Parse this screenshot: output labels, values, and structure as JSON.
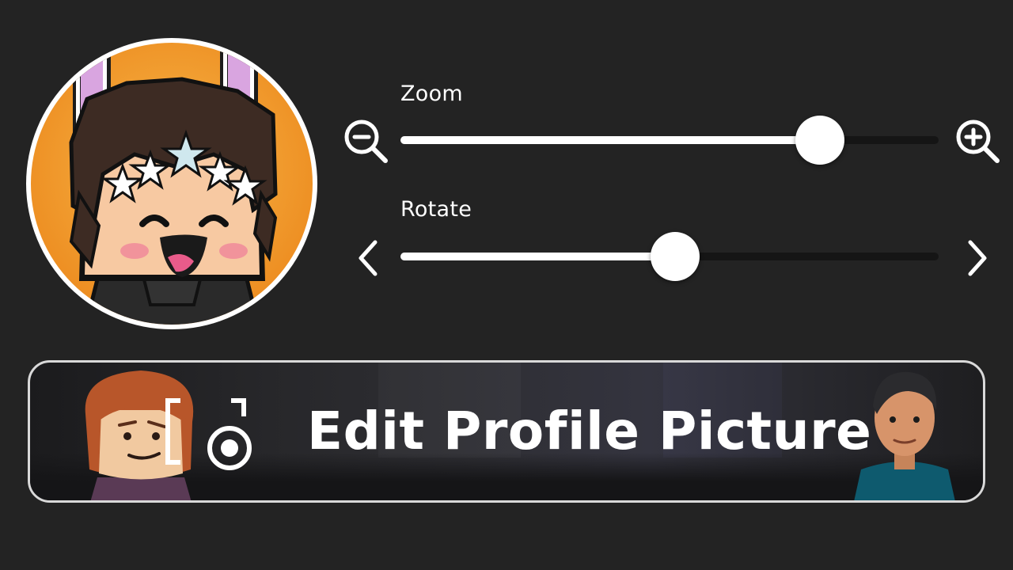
{
  "zoom": {
    "label": "Zoom",
    "value": 0.78
  },
  "rotate": {
    "label": "Rotate",
    "value": 0.51
  },
  "edit_button": {
    "label": "Edit Profile Picture"
  },
  "colors": {
    "background": "#232323",
    "track": "#151515",
    "fill": "#ffffff",
    "avatar_bg": "#f4a12c"
  },
  "icons": {
    "zoom_out": "zoom-out-icon",
    "zoom_in": "zoom-in-icon",
    "rotate_left": "chevron-left-icon",
    "rotate_right": "chevron-right-icon",
    "camera": "camera-frame-icon"
  }
}
